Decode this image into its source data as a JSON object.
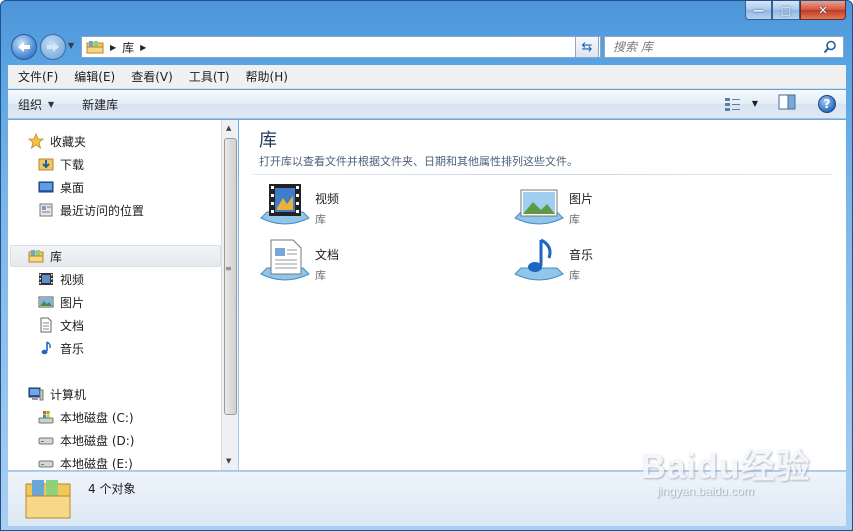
{
  "caption": {
    "minimize": "—",
    "maximize": "□",
    "close": "✕"
  },
  "address": {
    "crumb": "库"
  },
  "search": {
    "placeholder": "搜索 库"
  },
  "menu": [
    "文件(F)",
    "编辑(E)",
    "查看(V)",
    "工具(T)",
    "帮助(H)"
  ],
  "toolbar": {
    "organize": "组织",
    "new_library": "新建库",
    "help": "?"
  },
  "nav": {
    "favorites": "收藏夹",
    "downloads": "下载",
    "desktop": "桌面",
    "recent": "最近访问的位置",
    "libraries": "库",
    "videos": "视频",
    "pictures": "图片",
    "documents": "文档",
    "music": "音乐",
    "computer": "计算机",
    "drive_c": "本地磁盘 (C:)",
    "drive_d": "本地磁盘 (D:)",
    "drive_e": "本地磁盘 (E:)"
  },
  "content": {
    "title": "库",
    "description": "打开库以查看文件并根据文件夹、日期和其他属性排列这些文件。",
    "items": [
      {
        "name": "视频",
        "type": "库",
        "icon": "video-library-icon"
      },
      {
        "name": "图片",
        "type": "库",
        "icon": "picture-library-icon"
      },
      {
        "name": "文档",
        "type": "库",
        "icon": "document-library-icon"
      },
      {
        "name": "音乐",
        "type": "库",
        "icon": "music-library-icon"
      }
    ]
  },
  "details": {
    "count": "4 个对象"
  },
  "watermark": {
    "main": "Baidu经验",
    "sub": "jingyan.baidu.com"
  }
}
